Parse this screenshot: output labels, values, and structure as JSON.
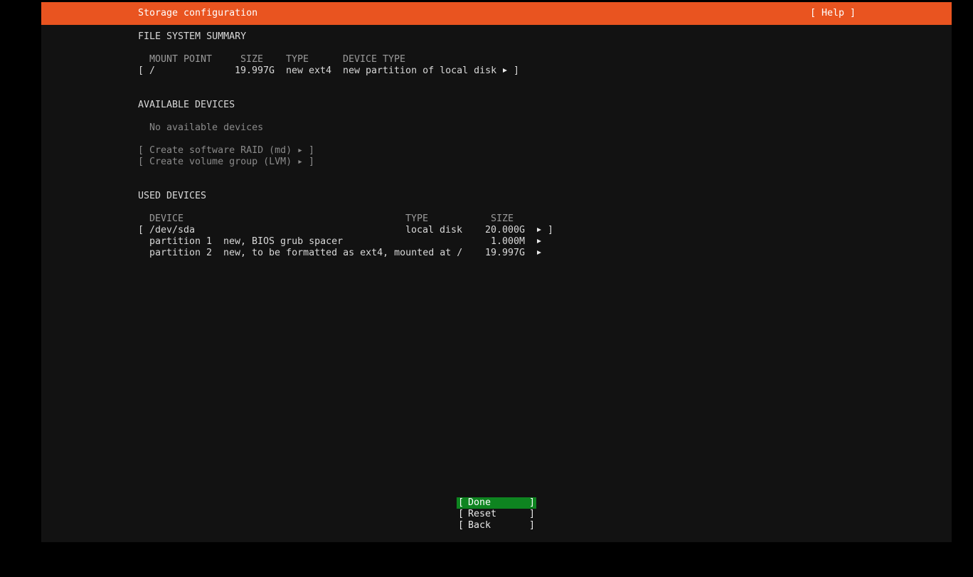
{
  "header": {
    "title": "Storage configuration",
    "help_label": "[ Help ]"
  },
  "filesystem_summary": {
    "heading": "FILE SYSTEM SUMMARY",
    "columns": [
      "MOUNT POINT",
      "SIZE",
      "TYPE",
      "DEVICE TYPE"
    ],
    "rows": [
      {
        "mount": "/",
        "size": "19.997G",
        "type": "new ext4",
        "device_type": "new partition of local disk"
      }
    ]
  },
  "available_devices": {
    "heading": "AVAILABLE DEVICES",
    "empty_text": "No available devices",
    "actions": [
      "Create software RAID (md)",
      "Create volume group (LVM)"
    ]
  },
  "used_devices": {
    "heading": "USED DEVICES",
    "columns": [
      "DEVICE",
      "TYPE",
      "SIZE"
    ],
    "device": {
      "name": "/dev/sda",
      "type": "local disk",
      "size": "20.000G"
    },
    "partitions": [
      {
        "name": "partition 1",
        "desc": "new, BIOS grub spacer",
        "size": "1.000M"
      },
      {
        "name": "partition 2",
        "desc": "new, to be formatted as ext4, mounted at /",
        "size": "19.997G"
      }
    ]
  },
  "buttons": {
    "done": "Done",
    "reset": "Reset",
    "back": "Back"
  },
  "colors": {
    "header_bg": "#e95420",
    "focus_bg": "#0e8420",
    "screen_bg": "#121212"
  }
}
